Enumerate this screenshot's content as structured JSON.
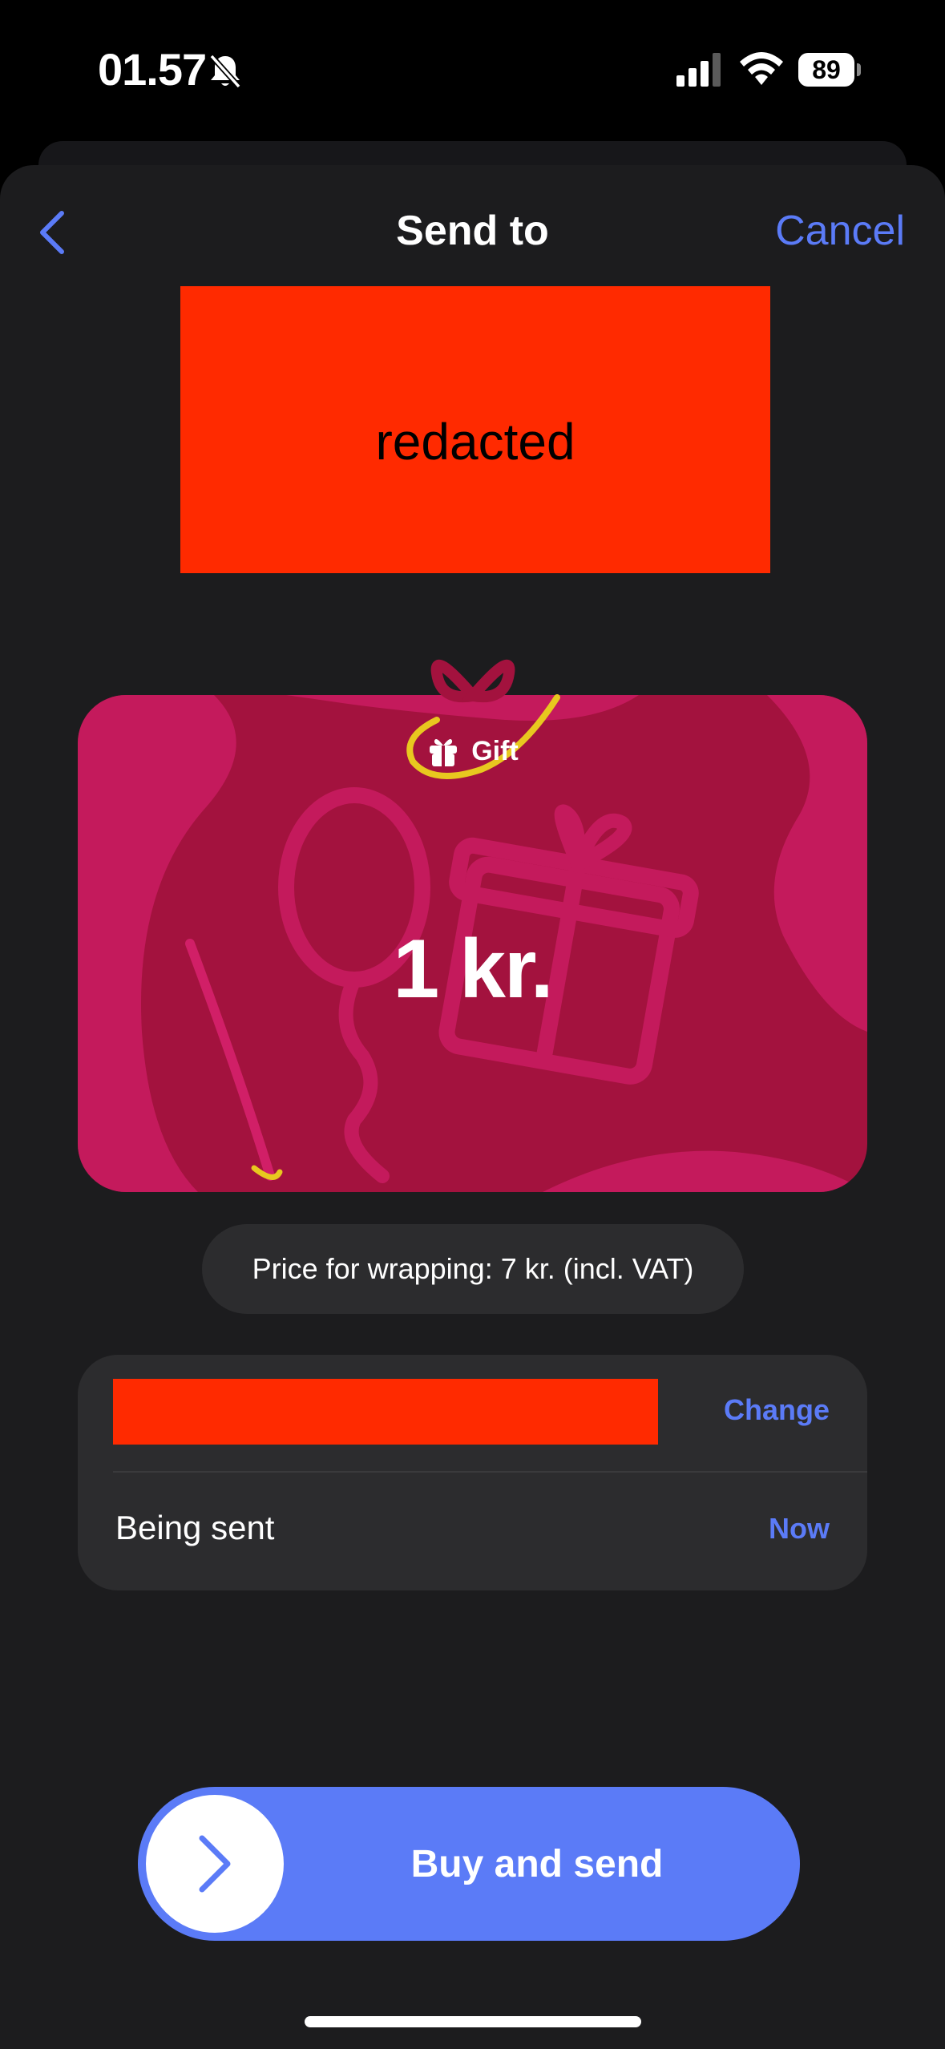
{
  "status_bar": {
    "time": "01.57",
    "battery": "89",
    "icons": [
      "bell-slash-icon",
      "signal-icon",
      "wifi-icon",
      "battery-icon"
    ]
  },
  "nav": {
    "back_icon": "chevron-left-icon",
    "title": "Send to",
    "cancel_label": "Cancel"
  },
  "redacted_header": {
    "text": "redacted"
  },
  "gift_card": {
    "badge_icon": "gift-icon",
    "badge_label": "Gift",
    "amount": "1 kr."
  },
  "price_note": "Price for wrapping: 7 kr. (incl. VAT)",
  "details": {
    "change_label": "Change",
    "sent_label": "Being sent",
    "sent_value": "Now"
  },
  "buy_button": {
    "icon": "chevron-right-icon",
    "label": "Buy and send"
  },
  "colors": {
    "accent": "#5b7bf7",
    "card": "#a3123e",
    "redacted": "#ff2a00",
    "background": "#1c1c1e"
  }
}
